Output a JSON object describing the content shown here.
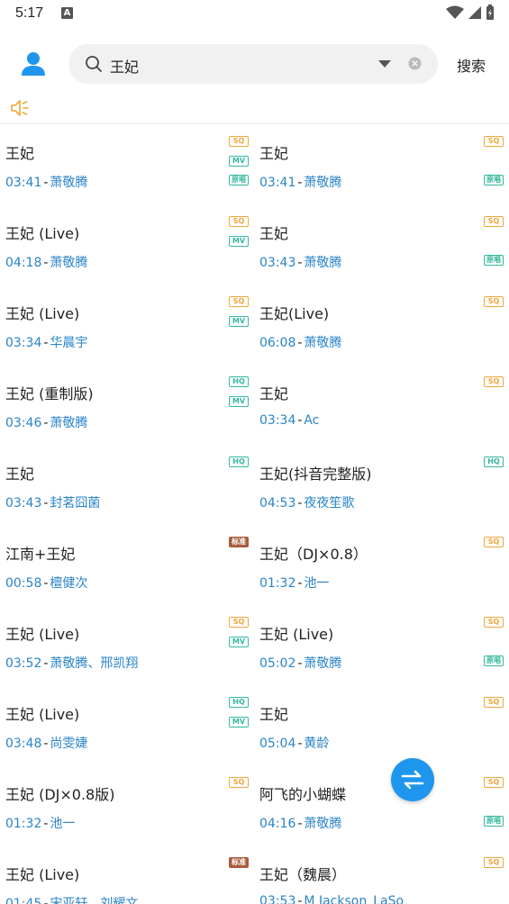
{
  "status": {
    "time": "5:17",
    "notif_badge": "A"
  },
  "search": {
    "query": "王妃",
    "button_label": "搜索"
  },
  "tag_labels": {
    "SQ": "SQ",
    "HQ": "HQ",
    "MV": "MV",
    "yuan": "原唱",
    "biao": "标准"
  },
  "songs": [
    {
      "title": "王妃",
      "duration": "03:41",
      "artist": "萧敬腾",
      "tags": [
        "SQ",
        "MV",
        "yuan"
      ]
    },
    {
      "title": "王妃",
      "duration": "03:41",
      "artist": "萧敬腾",
      "tags": [
        "SQ",
        "",
        "yuan"
      ]
    },
    {
      "title": "王妃 (Live)",
      "duration": "04:18",
      "artist": "萧敬腾",
      "tags": [
        "SQ",
        "MV"
      ]
    },
    {
      "title": "王妃",
      "duration": "03:43",
      "artist": "萧敬腾",
      "tags": [
        "SQ",
        "",
        "yuan"
      ]
    },
    {
      "title": "王妃 (Live)",
      "duration": "03:34",
      "artist": "华晨宇",
      "tags": [
        "SQ",
        "MV"
      ]
    },
    {
      "title": "王妃(Live)",
      "duration": "06:08",
      "artist": "萧敬腾",
      "tags": [
        "SQ"
      ]
    },
    {
      "title": "王妃 (重制版)",
      "duration": "03:46",
      "artist": "萧敬腾",
      "tags": [
        "HQ",
        "MV"
      ]
    },
    {
      "title": "王妃",
      "duration": "03:34",
      "artist": "Ac",
      "tags": [
        "SQ"
      ]
    },
    {
      "title": "王妃",
      "duration": "03:43",
      "artist": "封茗囧菌",
      "tags": [
        "HQ"
      ]
    },
    {
      "title": "王妃(抖音完整版)",
      "duration": "04:53",
      "artist": "夜夜笙歌",
      "tags": [
        "HQ"
      ]
    },
    {
      "title": "江南+王妃",
      "duration": "00:58",
      "artist": "檀健次",
      "tags": [
        "biao"
      ]
    },
    {
      "title": "王妃（DJ×0.8）",
      "duration": "01:32",
      "artist": "池一",
      "tags": [
        "SQ"
      ]
    },
    {
      "title": "王妃 (Live)",
      "duration": "03:52",
      "artist": "萧敬腾、邢凯翔",
      "tags": [
        "SQ",
        "MV"
      ]
    },
    {
      "title": "王妃 (Live)",
      "duration": "05:02",
      "artist": "萧敬腾",
      "tags": [
        "SQ",
        "",
        "yuan"
      ]
    },
    {
      "title": "王妃 (Live)",
      "duration": "03:48",
      "artist": "尚雯婕",
      "tags": [
        "HQ",
        "MV"
      ]
    },
    {
      "title": "王妃",
      "duration": "05:04",
      "artist": "黄龄",
      "tags": [
        "SQ"
      ]
    },
    {
      "title": "王妃 (DJ×0.8版)",
      "duration": "01:32",
      "artist": "池一",
      "tags": [
        "SQ"
      ]
    },
    {
      "title": "阿飞的小蝴蝶",
      "duration": "04:16",
      "artist": "萧敬腾",
      "tags": [
        "SQ",
        "",
        "yuan"
      ]
    },
    {
      "title": "王妃 (Live)",
      "duration": "01:45",
      "artist": "宋亚轩、刘耀文",
      "tags": [
        "biao"
      ]
    },
    {
      "title": "王妃（魏晨）",
      "duration": "03:53",
      "artist": "M Jackson_LaSo",
      "tags": [
        "SQ"
      ]
    }
  ],
  "colors": {
    "accent": "#1e96ee",
    "artist_text": "#2a84c8",
    "sq_tag": "#f0a63a",
    "hq_tag": "#34b8a0",
    "speaker": "#f0a63a"
  }
}
